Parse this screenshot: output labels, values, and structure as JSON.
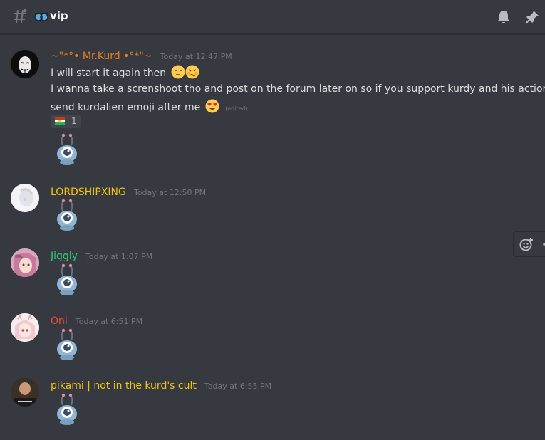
{
  "channel": {
    "name": "vip",
    "emoji_icon": "sunglasses-emoji-icon"
  },
  "header_icons": [
    "bell-icon",
    "pin-icon"
  ],
  "colors": {
    "background": "#36393f",
    "mrkurd": "#e67e22",
    "gold": "#f1c40f",
    "green": "#2ecc71",
    "red": "#e74c3c",
    "timestamp": "#72767d",
    "text": "#dcddde"
  },
  "messages": [
    {
      "author": "~\"*°• Mr.Kurd •°*\"~",
      "timestamp": "Today at 12:47 PM",
      "lines": [
        "I will start it again then",
        "I wanna take a screnshoot tho and post on the forum later on so if you support kurdy and his action",
        "send kurdalien emoji after me"
      ],
      "edited": "(edited)",
      "reaction": {
        "emoji": "kurdalien-emoji-icon",
        "count": "1"
      },
      "emoji": "kurdalien-emoji-icon"
    },
    {
      "author": "LORDSHIPXING",
      "timestamp": "Today at 12:50 PM",
      "emoji": "kurdalien-emoji-icon"
    },
    {
      "author": "Jiggly",
      "timestamp": "Today at 1:07 PM",
      "emoji": "kurdalien-emoji-icon"
    },
    {
      "author": "Oni",
      "timestamp": "Today at 6:51 PM",
      "emoji": "kurdalien-emoji-icon"
    },
    {
      "author": "pikami | not in the kurd's cult",
      "timestamp": "Today at 6:55 PM",
      "emoji": "kurdalien-emoji-icon"
    }
  ],
  "hover_toolbar": [
    "add-reaction-icon",
    "more-icon"
  ]
}
